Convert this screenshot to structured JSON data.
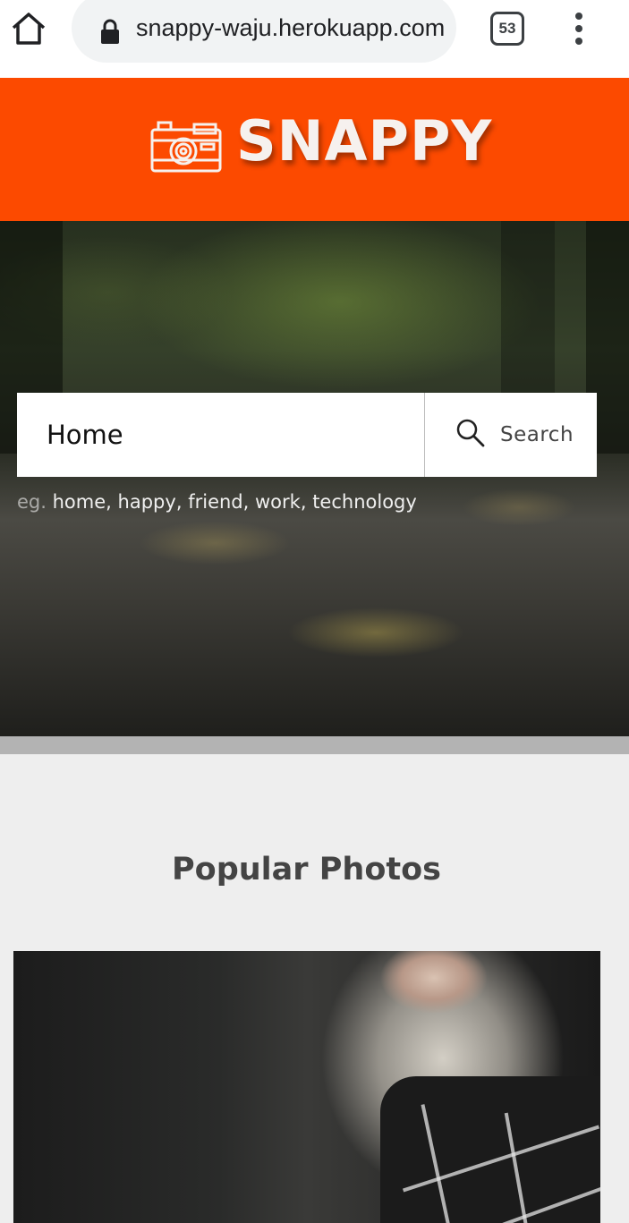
{
  "browser": {
    "url": "snappy-waju.herokuapp.com",
    "tab_count": "53"
  },
  "header": {
    "logo_text": "SNAPPY",
    "brand_color": "#fc4a00"
  },
  "search": {
    "value": "Home",
    "button_label": "Search",
    "hint_prefix": "eg.",
    "suggestions": [
      "home",
      "happy",
      "friend",
      "work",
      "technology"
    ]
  },
  "popular": {
    "title": "Popular Photos"
  },
  "icons": {
    "home": "home-icon",
    "lock": "lock-icon",
    "menu": "more-vertical-icon",
    "camera": "camera-icon",
    "search": "search-icon"
  }
}
